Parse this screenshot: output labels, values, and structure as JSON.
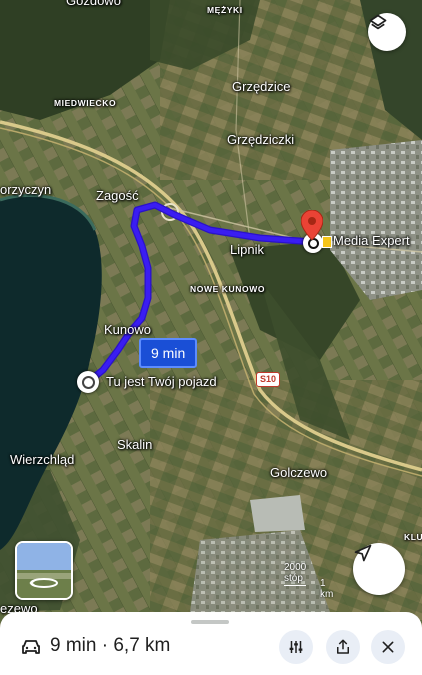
{
  "map": {
    "place_labels": {
      "gozdowo": "Gozdowo",
      "mezyki": "MĘŻYKI",
      "grzedzice": "Grzędzice",
      "miedwiecko": "MIEDWIECKO",
      "grzedziczki": "Grzędziczki",
      "morzyczyn": "orzyczyn",
      "zagosc": "Zagość",
      "lipnik": "Lipnik",
      "nowe_kunowo": "NOWE KUNOWO",
      "kunowo": "Kunowo",
      "skalin": "Skalin",
      "wierzchlad": "Wierzchląd",
      "golczewo": "Golczewo",
      "klu": "KLU",
      "lezewo": "ezewo"
    },
    "road_badge": "S10",
    "destination_label": "Media Expert",
    "origin_label": "Tu jest Twój pojazd",
    "eta_badge": "9 min",
    "scale": {
      "imperial": "2000 stóp",
      "metric": "1 km"
    },
    "colors": {
      "route": "#3a1df2",
      "pin": "#ea4335",
      "eta_badge": "#1a4fd6"
    }
  },
  "controls": {
    "layers_icon": "layers-icon",
    "recenter_icon": "navigation-arrow-icon"
  },
  "bottom_sheet": {
    "summary": "9 min · 6,7 km",
    "mode_icon": "car-icon",
    "filter_icon": "tune-icon",
    "share_icon": "share-icon",
    "close_icon": "close-icon"
  }
}
